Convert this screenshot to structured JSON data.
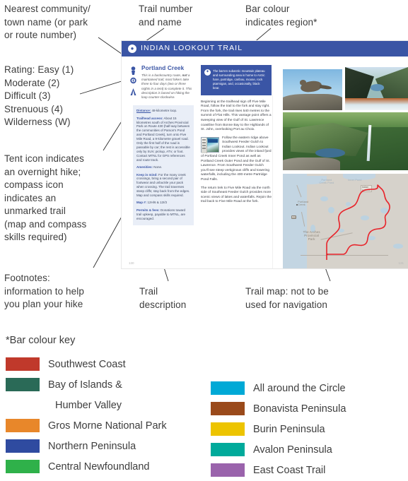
{
  "annotations": [
    {
      "id": "nearest-community",
      "text": "Nearest community/\ntown name (or park\nor route number)"
    },
    {
      "id": "trail-number-name",
      "text": "Trail number\nand name"
    },
    {
      "id": "bar-colour",
      "text": "Bar colour\nindicates region*"
    },
    {
      "id": "rating",
      "text": "Rating: Easy (1)\nModerate (2)\nDifficult (3)\nStrenuous (4)\nWilderness (W)"
    },
    {
      "id": "icons",
      "text": "Tent icon indicates\nan overnight hike;\ncompass icon\nindicates an\nunmarked trail\n(map and compass\nskills required)"
    },
    {
      "id": "footnotes",
      "text": "Footnotes:\ninformation to help\nyou plan your hike"
    },
    {
      "id": "trail-description",
      "text": "Trail\ndescription"
    },
    {
      "id": "trail-map",
      "text": "Trail map: not to be\nused for navigation"
    }
  ],
  "spread": {
    "header": {
      "title": "INDIAN LOOKOUT TRAIL",
      "icon": "trail-marker-icon",
      "bar_color": "#3a55a5"
    },
    "left_column": {
      "rating_icons": [
        "difficulty-rating-icon",
        "compass-icon",
        "tent-icon"
      ],
      "community": "Portland Creek",
      "intro_before_bold": "This is a backcountry route, ",
      "intro_bold": "not",
      "intro_after_bold": " a maintained trail; most hikers take three to four days (two or three nights in a tent) to complete it. This description is based on hiking the loop counter-clockwise.",
      "footnotes": [
        {
          "key": "Distance:",
          "value": " 48-kilometre loop.",
          "underline": true
        },
        {
          "key": "Trailhead access:",
          "value": " About 15 kilometres south of Arches Provincial Park on Route 430 (half-way between the communities of Parson's Pond and Portland Creek), turn onto Five Mile Road, a 9-kilometre gravel road. Only the first half of the road is passable by car; the rest is accessible only by SUV, pickup, ATV, or foot. Contact MTNL for GPS references and route track.",
          "underline": false
        },
        {
          "key": "Amenities:",
          "value": " None.",
          "underline": false
        },
        {
          "key": "Keep in mind:",
          "value": " For the many creek crossings, bring a second pair of footwear and unbuckle your pack when crossing. The trail traverses steep cliffs; stay back from the edges. Map and compass skills required.",
          "underline": false
        },
        {
          "key": "Map #:",
          "value": " 12H/6 & 12I/3",
          "underline": false
        },
        {
          "key": "Permits & fees:",
          "value": " Donations toward trail upkeep, payable to MTNL, are encouraged.",
          "underline": false
        }
      ]
    },
    "middle_column": {
      "callout_icon": "compass-rose-icon",
      "callout": "The barren subarctic mountain plateau and surrounding area is home to Arctic hare, partridge, caribou, moose, rock ptarmigan, and, occasionally, black bear.",
      "paragraphs": [
        "Beginning at the trailhead sign off Five Mile Road, follow the trail to the fork and stay right. From the fork, the trail rises 540 metres to the summit of Flat Hills. This vantage point offers a sweeping view of the Gulf of St. Lawrence coastline from Bonne Bay to the Highlands of St. John, overlooking Port au Choix.",
        "Follow the eastern ridge above Southwest Feeder Gulch to Indian Lookout. Indian Lookout provides views of the inland fjord of Portland Creek Inner Pond as well as Portland Creek Outer Pond and the Gulf of St. Lawrence. From Southwest Feeder Gulch you'll see steep vertiginous cliffs and towering waterfalls, including the 400-metre Partridge Pond Falls.",
        "The return trek to Five Mile Road via the north side of Southeast Feeder Gulch provides more scenic views of lakes and waterfalls. Rejoin the trail back to Five Mile Road at the fork."
      ],
      "book_thumbnail": "guidebook-cover-thumbnail"
    },
    "right_column": {
      "photos": [
        {
          "id": "photo-ptarmigan",
          "caption": "rock ptarmigan perched on lichen-covered rock"
        },
        {
          "id": "photo-gorge",
          "caption": "steep gorge with pond and waterfall"
        },
        {
          "id": "photo-valley",
          "caption": "green valley with tall waterfall"
        }
      ],
      "map": {
        "id": "trail-map",
        "route_color": "#e8232a",
        "labels": [
          "Portland Creek Pond",
          "Inner Pond",
          "Indian Lookout",
          "Portland Creek",
          "The Arches Provincial Park"
        ],
        "route_shield": "430",
        "trailhead_label": "Indian Lookout"
      }
    },
    "page_numbers": {
      "left": "130",
      "right": "131"
    }
  },
  "colour_key": {
    "title": "*Bar colour key",
    "left": [
      {
        "label": "Southwest Coast",
        "color": "#c0392b",
        "swatch": true
      },
      {
        "label": "Bay of Islands &",
        "color": "#2a6a57",
        "swatch": true
      },
      {
        "label": "Humber Valley",
        "color": "",
        "swatch": false
      },
      {
        "label": "Gros Morne National Park",
        "color": "#e8872a",
        "swatch": true
      },
      {
        "label": "Northern Peninsula",
        "color": "#2f4ba0",
        "swatch": true
      },
      {
        "label": "Central Newfoundland",
        "color": "#2fb14a",
        "swatch": true
      }
    ],
    "right": [
      {
        "label": "All around the Circle",
        "color": "#00a9d6",
        "swatch": true
      },
      {
        "label": "Bonavista Peninsula",
        "color": "#9a4a1b",
        "swatch": true
      },
      {
        "label": "Burin Peninsula",
        "color": "#edc400",
        "swatch": true
      },
      {
        "label": "Avalon Peninsula",
        "color": "#00aa9b",
        "swatch": true
      },
      {
        "label": "East Coast Trail",
        "color": "#9a63ac",
        "swatch": true
      }
    ]
  }
}
